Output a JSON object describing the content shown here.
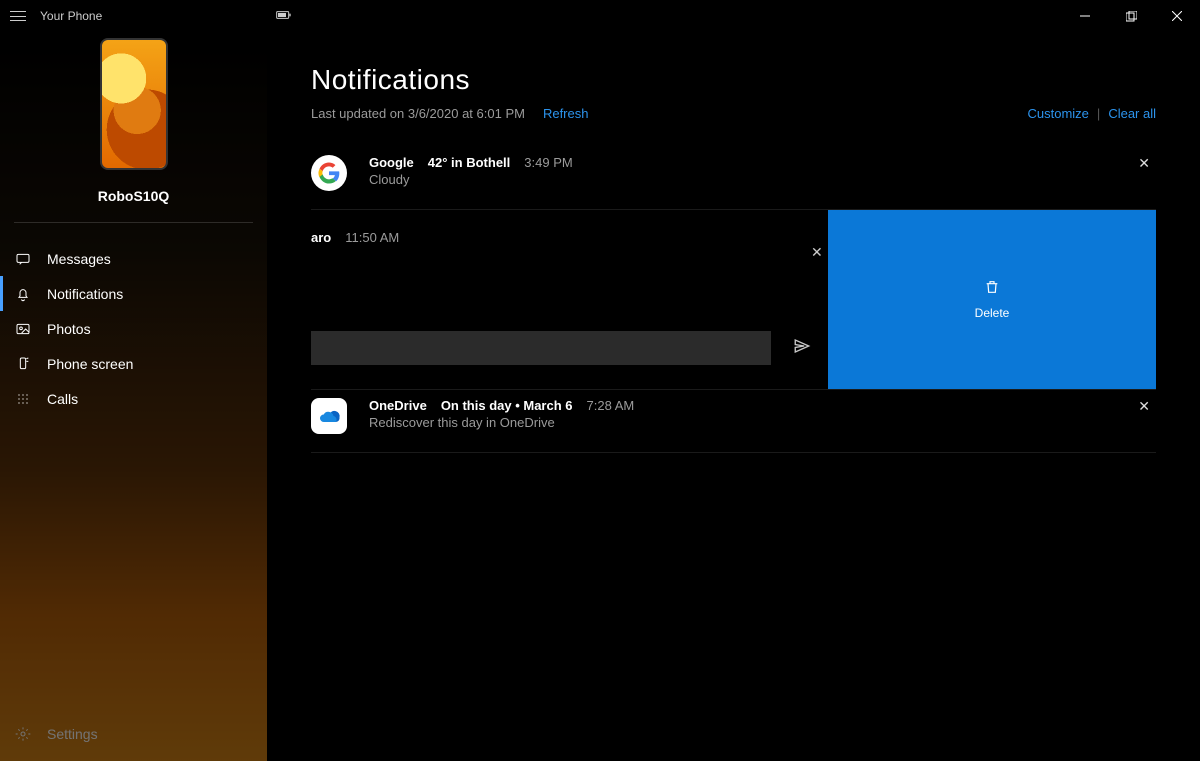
{
  "window": {
    "title": "Your Phone",
    "device_name": "RoboS10Q"
  },
  "sidebar": {
    "items": [
      {
        "label": "Messages"
      },
      {
        "label": "Notifications"
      },
      {
        "label": "Photos"
      },
      {
        "label": "Phone screen"
      },
      {
        "label": "Calls"
      }
    ],
    "settings_label": "Settings"
  },
  "page": {
    "title": "Notifications",
    "last_updated": "Last updated on 3/6/2020 at 6:01 PM",
    "refresh_label": "Refresh",
    "customize_label": "Customize",
    "clear_all_label": "Clear all"
  },
  "notifications": [
    {
      "app": "Google",
      "title": "42° in Bothell",
      "time": "3:49 PM",
      "subtitle": "Cloudy"
    },
    {
      "app": "aro",
      "time": "11:50 AM",
      "delete_label": "Delete"
    },
    {
      "app": "OneDrive",
      "title": "On this day • March 6",
      "time": "7:28 AM",
      "subtitle": "Rediscover this day in OneDrive"
    }
  ]
}
